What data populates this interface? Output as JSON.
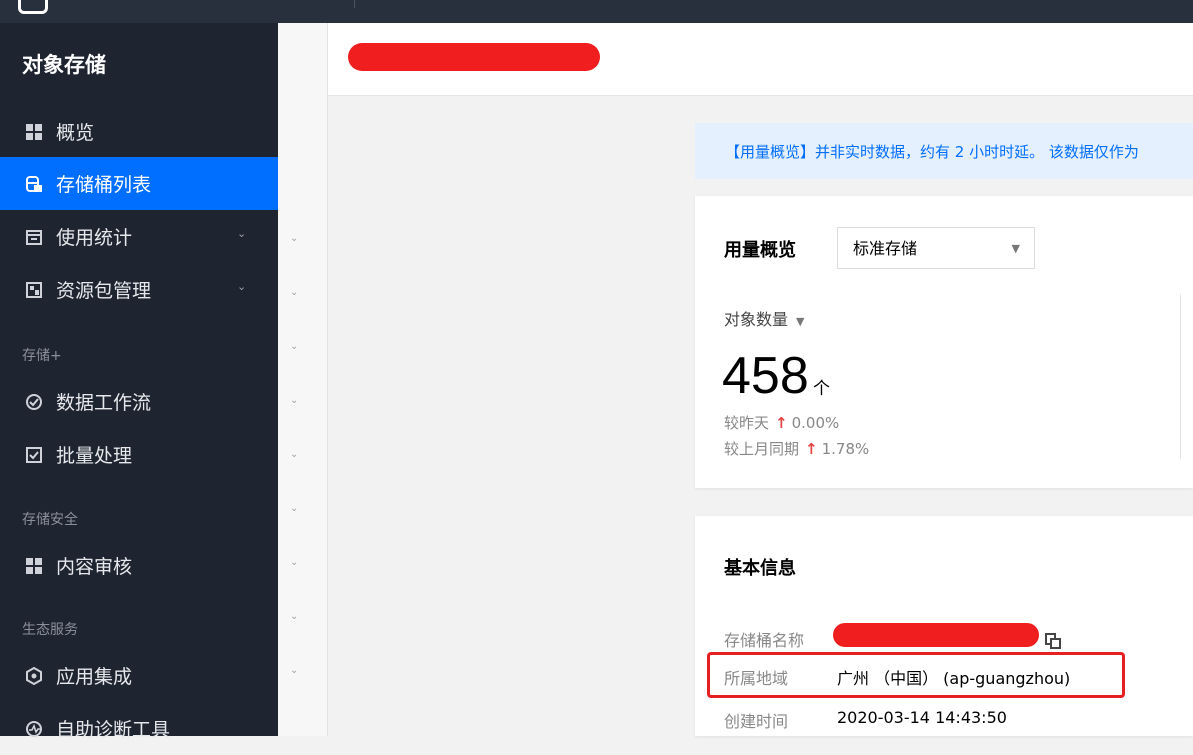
{
  "topbar": {
    "logo_icon": "cloud-logo-icon"
  },
  "sidebar": {
    "title": "对象存储",
    "items": [
      {
        "label": "概览",
        "icon": "grid-icon",
        "active": false
      },
      {
        "label": "存储桶列表",
        "icon": "bucket-icon",
        "active": true
      },
      {
        "label": "使用统计",
        "icon": "calendar-icon",
        "active": false,
        "expandable": true
      },
      {
        "label": "资源包管理",
        "icon": "package-icon",
        "active": false,
        "expandable": true
      }
    ],
    "group_storage_plus": "存储+",
    "items_storage_plus": [
      {
        "label": "数据工作流",
        "icon": "workflow-icon"
      },
      {
        "label": "批量处理",
        "icon": "batch-icon"
      }
    ],
    "group_security": "存储安全",
    "items_security": [
      {
        "label": "内容审核",
        "icon": "grid-icon"
      }
    ],
    "group_ecosystem": "生态服务",
    "items_ecosystem": [
      {
        "label": "应用集成",
        "icon": "integration-icon"
      },
      {
        "label": "自助诊断工具",
        "icon": "diagnose-icon"
      }
    ]
  },
  "notice": {
    "text": "【用量概览】并非实时数据，约有 2 小时时延。 该数据仅作为"
  },
  "usage": {
    "title": "用量概览",
    "storage_class": "标准存储",
    "metric_label": "对象数量",
    "value": "458",
    "unit": "个",
    "day_label": "较昨天",
    "day_change": "0.00%",
    "month_label": "较上月同期",
    "month_change": "1.78%"
  },
  "basic": {
    "title": "基本信息",
    "bucket_name_label": "存储桶名称",
    "region_label": "所属地域",
    "region_value": "广州 （中国） (ap-guangzhou)",
    "created_label": "创建时间",
    "created_value": "2020-03-14 14:43:50"
  },
  "colors": {
    "accent": "#006eff",
    "sidebar_bg": "#1f2431",
    "highlight": "#e62020",
    "up": "#e54545"
  }
}
